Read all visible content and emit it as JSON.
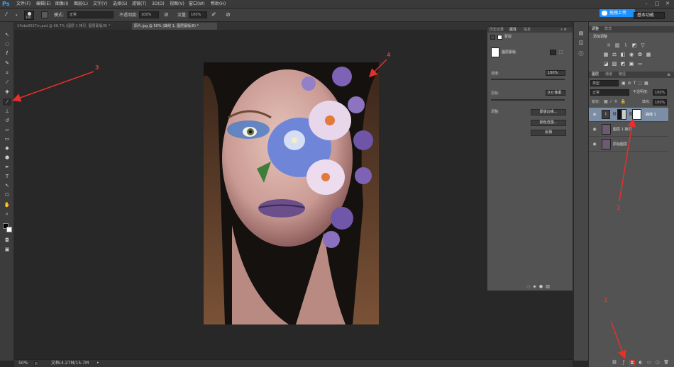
{
  "app": {
    "logo": "Ps",
    "menu": [
      "文件(F)",
      "编辑(E)",
      "图像(I)",
      "图层(L)",
      "文字(Y)",
      "选择(S)",
      "滤镜(T)",
      "3D(D)",
      "视图(V)",
      "窗口(W)",
      "帮助(H)"
    ]
  },
  "options": {
    "brush_size": "100",
    "mode_label": "模式:",
    "mode_value": "正常",
    "opacity_label": "不透明度:",
    "opacity_value": "100%",
    "flow_label": "流量:",
    "flow_value": "100%",
    "upload_button": "拖拽上传",
    "workspace": "基本功能"
  },
  "tabs": [
    {
      "label": "14ebs0027m.psd @ 66.7% (图层 1 拷贝, 图层蒙版/8) *",
      "active": false
    },
    {
      "label": "原片.jpg @ 50% (曲线 1, 图层蒙版/8) *",
      "active": true
    }
  ],
  "status": {
    "zoom": "50%",
    "doc": "文档:4.27M/15.7M"
  },
  "properties": {
    "tabs": [
      "历史记录",
      "属性",
      "信息"
    ],
    "header": "蒙版",
    "mask_title": "图层蒙版",
    "density_label": "浓度:",
    "density_value": "100%",
    "feather_label": "羽化:",
    "feather_value": "0.0 像素",
    "refine_label": "调整:",
    "buttons": [
      "蒙版边缘...",
      "颜色范围...",
      "反相"
    ]
  },
  "adjustments": {
    "tabs": [
      "调整",
      "样式"
    ],
    "title": "添加调整"
  },
  "layers": {
    "tabs": [
      "图层",
      "通道",
      "路径"
    ],
    "kind": "类型",
    "blend": "正常",
    "opacity_label": "不透明度:",
    "opacity_value": "100%",
    "lock_label": "锁定:",
    "fill_label": "填充:",
    "fill_value": "100%",
    "items": [
      {
        "name": "曲线 1",
        "selected": true
      },
      {
        "name": "图层 1 拷贝",
        "selected": false
      },
      {
        "name": "原始图层",
        "selected": false
      }
    ]
  },
  "annotations": [
    "1",
    "2",
    "3",
    "4"
  ],
  "colors": {
    "arrow": "#e8302a",
    "selected_layer": "#7b8ea6",
    "upload_blue": "#1e90ff"
  }
}
